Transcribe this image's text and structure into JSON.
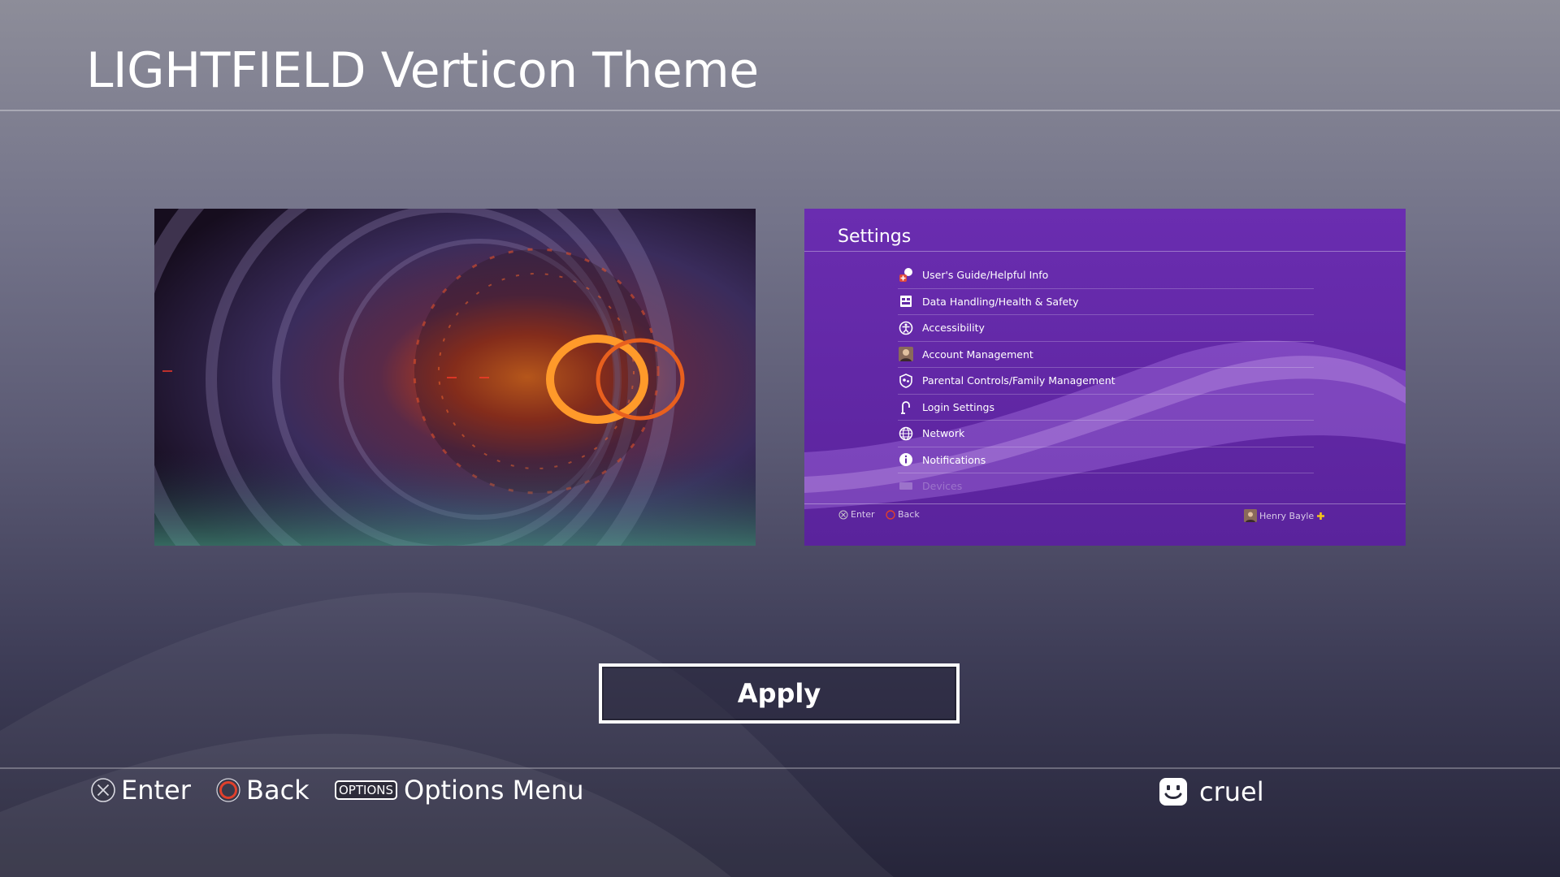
{
  "page": {
    "title": "LIGHTFIELD Verticon Theme"
  },
  "previews": {
    "wallpaper": {
      "description_icon": "tunnel-wallpaper"
    },
    "settings": {
      "title": "Settings",
      "items": [
        {
          "label": "User's Guide/Helpful Info",
          "icon": "guide-icon"
        },
        {
          "label": "Data Handling/Health & Safety",
          "icon": "data-handling-icon"
        },
        {
          "label": "Accessibility",
          "icon": "accessibility-icon"
        },
        {
          "label": "Account Management",
          "icon": "account-avatar-icon"
        },
        {
          "label": "Parental Controls/Family Management",
          "icon": "parental-controls-icon"
        },
        {
          "label": "Login Settings",
          "icon": "login-icon"
        },
        {
          "label": "Network",
          "icon": "globe-icon"
        },
        {
          "label": "Notifications",
          "icon": "info-icon"
        },
        {
          "label": "Devices",
          "icon": "devices-icon"
        }
      ],
      "footer": {
        "enter_label": "Enter",
        "back_label": "Back",
        "user_name": "Henry Bayle"
      }
    }
  },
  "actions": {
    "apply_label": "Apply"
  },
  "footer": {
    "enter_label": "Enter",
    "back_label": "Back",
    "options_badge": "OPTIONS",
    "options_label": "Options Menu",
    "user_name": "cruel"
  },
  "colors": {
    "settings_bg": "#6228a6",
    "back_circle": "#e0402c",
    "plus_gold": "#f5c518"
  }
}
